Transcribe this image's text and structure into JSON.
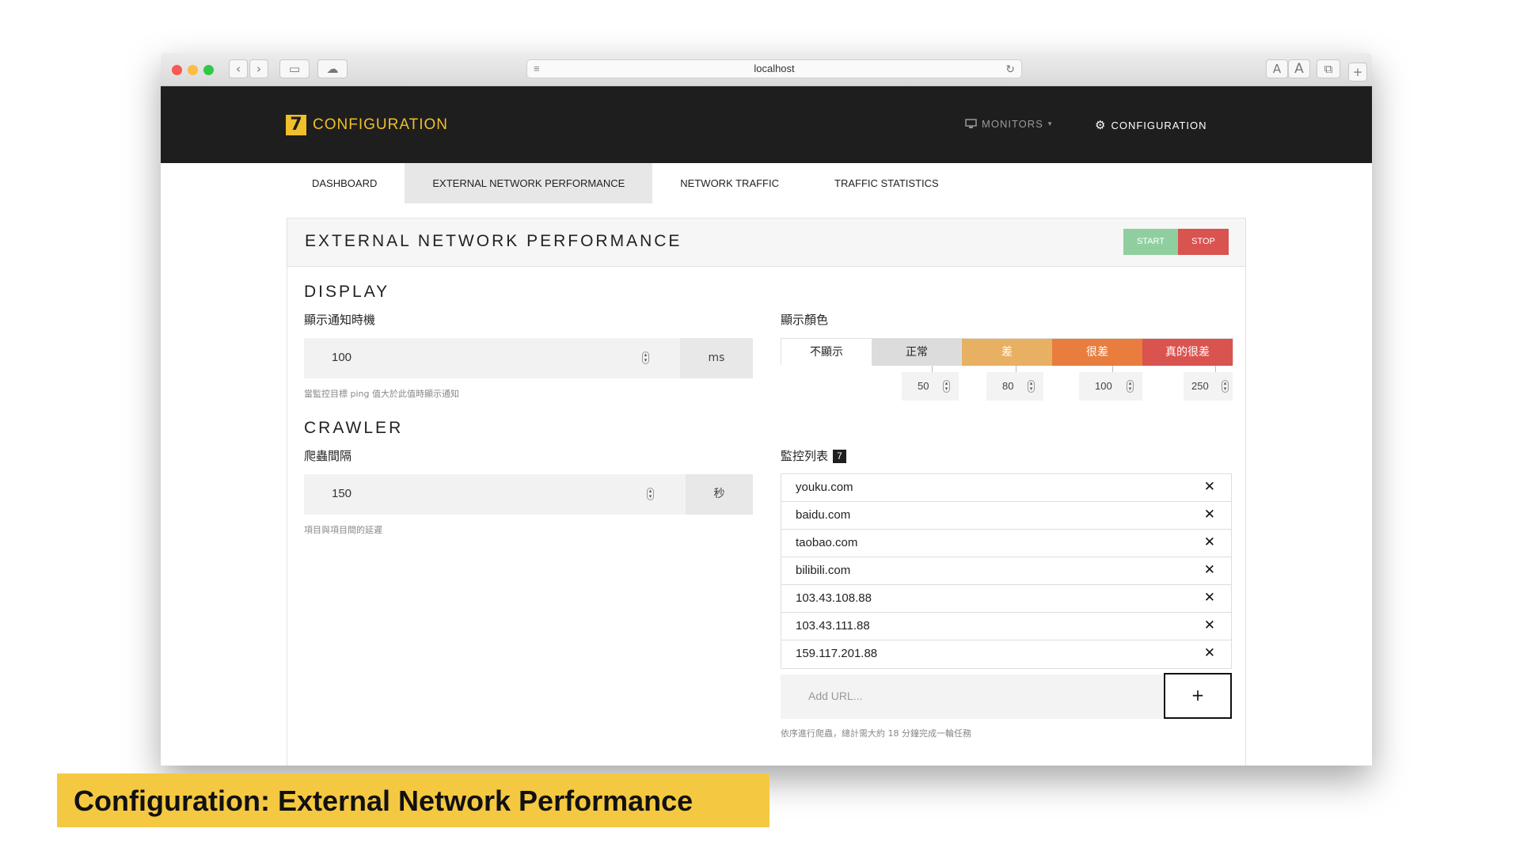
{
  "browser": {
    "url": "localhost",
    "font_small_label": "A",
    "font_large_label": "A",
    "new_tab_label": "+"
  },
  "app": {
    "brand_logo": "7",
    "brand_title": "CONFIGURATION",
    "nav_monitors": "MONITORS",
    "nav_configuration": "CONFIGURATION"
  },
  "tabs": [
    {
      "label": "DASHBOARD",
      "active": false
    },
    {
      "label": "EXTERNAL NETWORK PERFORMANCE",
      "active": true
    },
    {
      "label": "NETWORK TRAFFIC",
      "active": false
    },
    {
      "label": "TRAFFIC STATISTICS",
      "active": false
    }
  ],
  "panel": {
    "title": "EXTERNAL NETWORK PERFORMANCE",
    "start_label": "START",
    "stop_label": "STOP",
    "colors": {
      "start": "#8fcf9f",
      "stop": "#d9534f"
    }
  },
  "display": {
    "section_title": "DISPLAY",
    "notify_label": "顯示通知時機",
    "notify_value": "100",
    "notify_unit": "ms",
    "notify_help": "當監控目標 ping 值大於此值時顯示通知",
    "color_label": "顯示顏色",
    "color_scale": [
      {
        "label": "不顯示",
        "bg": "#ffffff",
        "fg": "#222222"
      },
      {
        "label": "正常",
        "bg": "#dcdcdc",
        "fg": "#222222"
      },
      {
        "label": "差",
        "bg": "#e8b063",
        "fg": "#ffffff"
      },
      {
        "label": "很差",
        "bg": "#e87d3e",
        "fg": "#ffffff"
      },
      {
        "label": "真的很差",
        "bg": "#d9534f",
        "fg": "#ffffff"
      }
    ],
    "thresholds": [
      "50",
      "80",
      "100",
      "250"
    ]
  },
  "crawler": {
    "section_title": "CRAWLER",
    "interval_label": "爬蟲間隔",
    "interval_value": "150",
    "interval_unit": "秒",
    "interval_help": "項目與項目間的延遲"
  },
  "monitors": {
    "label": "監控列表",
    "count": "7",
    "items": [
      "youku.com",
      "baidu.com",
      "taobao.com",
      "bilibili.com",
      "103.43.108.88",
      "103.43.111.88",
      "159.117.201.88"
    ],
    "delete_glyph": "✕",
    "add_placeholder": "Add URL...",
    "add_button": "+",
    "help": "依序進行爬蟲，總計需大約 18 分鐘完成一輪任務"
  },
  "caption": "Configuration: External Network Performance"
}
